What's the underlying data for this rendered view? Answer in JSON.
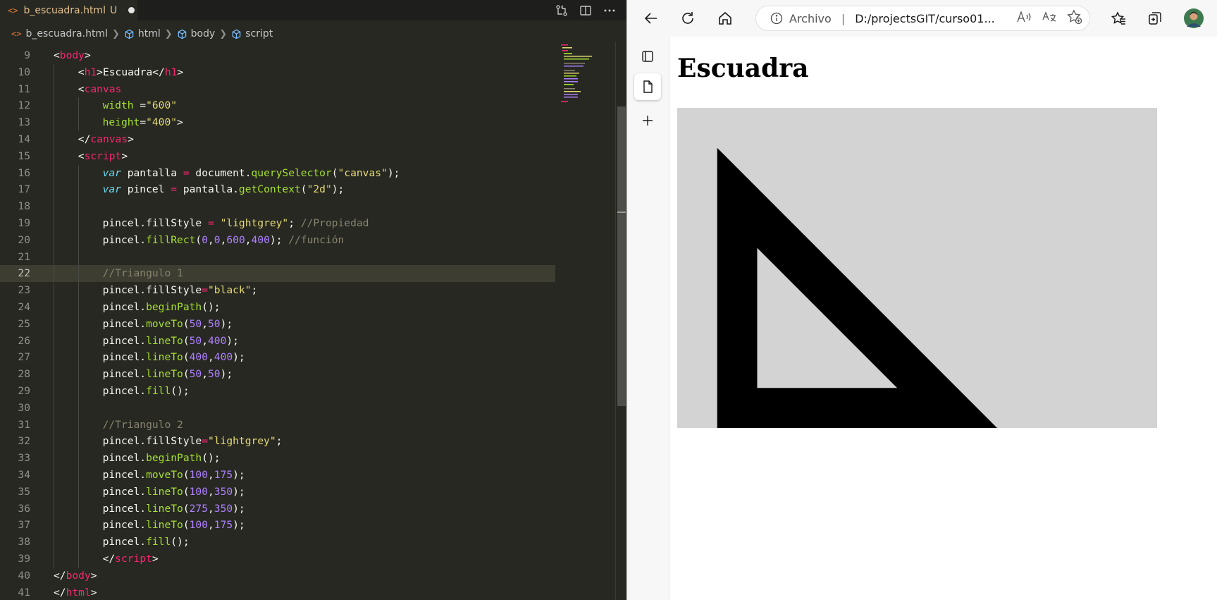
{
  "editor": {
    "tab": {
      "icon": "<>",
      "filename": "b_escuadra.html",
      "badge": "U"
    },
    "breadcrumb": [
      "b_escuadra.html",
      "html",
      "body",
      "script"
    ],
    "current_line": 22,
    "lines": [
      {
        "n": "9",
        "indent": 0,
        "tokens": [
          [
            "t-punc",
            "<"
          ],
          [
            "t-tag",
            "body"
          ],
          [
            "t-punc",
            ">"
          ]
        ]
      },
      {
        "n": "10",
        "indent": 1,
        "tokens": [
          [
            "t-punc",
            "<"
          ],
          [
            "t-tag",
            "h1"
          ],
          [
            "t-punc",
            ">Escuadra</"
          ],
          [
            "t-tag",
            "h1"
          ],
          [
            "t-punc",
            ">"
          ]
        ]
      },
      {
        "n": "11",
        "indent": 1,
        "tokens": [
          [
            "t-punc",
            "<"
          ],
          [
            "t-tag",
            "canvas"
          ]
        ]
      },
      {
        "n": "12",
        "indent": 2,
        "tokens": [
          [
            "t-attr",
            "width"
          ],
          [
            "t-punc",
            " ="
          ],
          [
            "t-str",
            "\"600\""
          ]
        ]
      },
      {
        "n": "13",
        "indent": 2,
        "tokens": [
          [
            "t-attr",
            "height"
          ],
          [
            "t-punc",
            "="
          ],
          [
            "t-str",
            "\"400\""
          ],
          [
            "t-punc",
            ">"
          ]
        ]
      },
      {
        "n": "14",
        "indent": 1,
        "tokens": [
          [
            "t-punc",
            "</"
          ],
          [
            "t-tag",
            "canvas"
          ],
          [
            "t-punc",
            ">"
          ]
        ]
      },
      {
        "n": "15",
        "indent": 1,
        "tokens": [
          [
            "t-punc",
            "<"
          ],
          [
            "t-tag",
            "script"
          ],
          [
            "t-punc",
            ">"
          ]
        ]
      },
      {
        "n": "16",
        "indent": 2,
        "tokens": [
          [
            "t-kw",
            "var"
          ],
          [
            "t-plain",
            " pantalla "
          ],
          [
            "t-op",
            "="
          ],
          [
            "t-plain",
            " document."
          ],
          [
            "t-fn",
            "querySelector"
          ],
          [
            "t-plain",
            "("
          ],
          [
            "t-str",
            "\"canvas\""
          ],
          [
            "t-plain",
            ");"
          ]
        ]
      },
      {
        "n": "17",
        "indent": 2,
        "tokens": [
          [
            "t-kw",
            "var"
          ],
          [
            "t-plain",
            " pincel "
          ],
          [
            "t-op",
            "="
          ],
          [
            "t-plain",
            " pantalla."
          ],
          [
            "t-fn",
            "getContext"
          ],
          [
            "t-plain",
            "("
          ],
          [
            "t-str",
            "\"2d\""
          ],
          [
            "t-plain",
            ");"
          ]
        ]
      },
      {
        "n": "18",
        "indent": 2,
        "tokens": []
      },
      {
        "n": "19",
        "indent": 2,
        "tokens": [
          [
            "t-plain",
            "pincel.fillStyle "
          ],
          [
            "t-op",
            "="
          ],
          [
            "t-plain",
            " "
          ],
          [
            "t-str",
            "\"lightgrey\""
          ],
          [
            "t-plain",
            "; "
          ],
          [
            "t-com",
            "//Propiedad"
          ]
        ]
      },
      {
        "n": "20",
        "indent": 2,
        "tokens": [
          [
            "t-plain",
            "pincel."
          ],
          [
            "t-fn",
            "fillRect"
          ],
          [
            "t-plain",
            "("
          ],
          [
            "t-num",
            "0"
          ],
          [
            "t-plain",
            ","
          ],
          [
            "t-num",
            "0"
          ],
          [
            "t-plain",
            ","
          ],
          [
            "t-num",
            "600"
          ],
          [
            "t-plain",
            ","
          ],
          [
            "t-num",
            "400"
          ],
          [
            "t-plain",
            "); "
          ],
          [
            "t-com",
            "//función"
          ]
        ]
      },
      {
        "n": "21",
        "indent": 2,
        "tokens": []
      },
      {
        "n": "22",
        "indent": 2,
        "tokens": [
          [
            "t-com",
            "//Triangulo 1"
          ]
        ]
      },
      {
        "n": "23",
        "indent": 2,
        "tokens": [
          [
            "t-plain",
            "pincel.fillStyle"
          ],
          [
            "t-op",
            "="
          ],
          [
            "t-str",
            "\"black\""
          ],
          [
            "t-plain",
            ";"
          ]
        ]
      },
      {
        "n": "24",
        "indent": 2,
        "tokens": [
          [
            "t-plain",
            "pincel."
          ],
          [
            "t-fn",
            "beginPath"
          ],
          [
            "t-plain",
            "();"
          ]
        ]
      },
      {
        "n": "25",
        "indent": 2,
        "tokens": [
          [
            "t-plain",
            "pincel."
          ],
          [
            "t-fn",
            "moveTo"
          ],
          [
            "t-plain",
            "("
          ],
          [
            "t-num",
            "50"
          ],
          [
            "t-plain",
            ","
          ],
          [
            "t-num",
            "50"
          ],
          [
            "t-plain",
            ");"
          ]
        ]
      },
      {
        "n": "26",
        "indent": 2,
        "tokens": [
          [
            "t-plain",
            "pincel."
          ],
          [
            "t-fn",
            "lineTo"
          ],
          [
            "t-plain",
            "("
          ],
          [
            "t-num",
            "50"
          ],
          [
            "t-plain",
            ","
          ],
          [
            "t-num",
            "400"
          ],
          [
            "t-plain",
            ");"
          ]
        ]
      },
      {
        "n": "27",
        "indent": 2,
        "tokens": [
          [
            "t-plain",
            "pincel."
          ],
          [
            "t-fn",
            "lineTo"
          ],
          [
            "t-plain",
            "("
          ],
          [
            "t-num",
            "400"
          ],
          [
            "t-plain",
            ","
          ],
          [
            "t-num",
            "400"
          ],
          [
            "t-plain",
            ");"
          ]
        ]
      },
      {
        "n": "28",
        "indent": 2,
        "tokens": [
          [
            "t-plain",
            "pincel."
          ],
          [
            "t-fn",
            "lineTo"
          ],
          [
            "t-plain",
            "("
          ],
          [
            "t-num",
            "50"
          ],
          [
            "t-plain",
            ","
          ],
          [
            "t-num",
            "50"
          ],
          [
            "t-plain",
            ");"
          ]
        ]
      },
      {
        "n": "29",
        "indent": 2,
        "tokens": [
          [
            "t-plain",
            "pincel."
          ],
          [
            "t-fn",
            "fill"
          ],
          [
            "t-plain",
            "();"
          ]
        ]
      },
      {
        "n": "30",
        "indent": 2,
        "tokens": []
      },
      {
        "n": "31",
        "indent": 2,
        "tokens": [
          [
            "t-com",
            "//Triangulo 2"
          ]
        ]
      },
      {
        "n": "32",
        "indent": 2,
        "tokens": [
          [
            "t-plain",
            "pincel.fillStyle"
          ],
          [
            "t-op",
            "="
          ],
          [
            "t-str",
            "\"lightgrey\""
          ],
          [
            "t-plain",
            ";"
          ]
        ]
      },
      {
        "n": "33",
        "indent": 2,
        "tokens": [
          [
            "t-plain",
            "pincel."
          ],
          [
            "t-fn",
            "beginPath"
          ],
          [
            "t-plain",
            "();"
          ]
        ]
      },
      {
        "n": "34",
        "indent": 2,
        "tokens": [
          [
            "t-plain",
            "pincel."
          ],
          [
            "t-fn",
            "moveTo"
          ],
          [
            "t-plain",
            "("
          ],
          [
            "t-num",
            "100"
          ],
          [
            "t-plain",
            ","
          ],
          [
            "t-num",
            "175"
          ],
          [
            "t-plain",
            ");"
          ]
        ]
      },
      {
        "n": "35",
        "indent": 2,
        "tokens": [
          [
            "t-plain",
            "pincel."
          ],
          [
            "t-fn",
            "lineTo"
          ],
          [
            "t-plain",
            "("
          ],
          [
            "t-num",
            "100"
          ],
          [
            "t-plain",
            ","
          ],
          [
            "t-num",
            "350"
          ],
          [
            "t-plain",
            ");"
          ]
        ]
      },
      {
        "n": "36",
        "indent": 2,
        "tokens": [
          [
            "t-plain",
            "pincel."
          ],
          [
            "t-fn",
            "lineTo"
          ],
          [
            "t-plain",
            "("
          ],
          [
            "t-num",
            "275"
          ],
          [
            "t-plain",
            ","
          ],
          [
            "t-num",
            "350"
          ],
          [
            "t-plain",
            ");"
          ]
        ]
      },
      {
        "n": "37",
        "indent": 2,
        "tokens": [
          [
            "t-plain",
            "pincel."
          ],
          [
            "t-fn",
            "lineTo"
          ],
          [
            "t-plain",
            "("
          ],
          [
            "t-num",
            "100"
          ],
          [
            "t-plain",
            ","
          ],
          [
            "t-num",
            "175"
          ],
          [
            "t-plain",
            ");"
          ]
        ]
      },
      {
        "n": "38",
        "indent": 2,
        "tokens": [
          [
            "t-plain",
            "pincel."
          ],
          [
            "t-fn",
            "fill"
          ],
          [
            "t-plain",
            "();"
          ]
        ]
      },
      {
        "n": "39",
        "indent": 2,
        "tokens": [
          [
            "t-punc",
            "</"
          ],
          [
            "t-tag",
            "script"
          ],
          [
            "t-punc",
            ">"
          ]
        ]
      },
      {
        "n": "40",
        "indent": 0,
        "tokens": [
          [
            "t-punc",
            "</"
          ],
          [
            "t-tag",
            "body"
          ],
          [
            "t-punc",
            ">"
          ]
        ]
      },
      {
        "n": "41",
        "indent": 0,
        "tokens": [
          [
            "t-punc",
            "</"
          ],
          [
            "t-tag",
            "html"
          ],
          [
            "t-punc",
            ">"
          ]
        ]
      }
    ]
  },
  "browser": {
    "address": {
      "label": "Archivo",
      "url": "D:/projectsGIT/curso01..."
    },
    "page": {
      "heading": "Escuadra",
      "canvas_bg": "#d3d3d3",
      "triangle1_color": "#000000",
      "triangle2_color": "#d3d3d3"
    }
  },
  "colors": {
    "editor_bg": "#272822",
    "tab_modified": "#e2c08d",
    "current_line": "#3e3d32"
  }
}
